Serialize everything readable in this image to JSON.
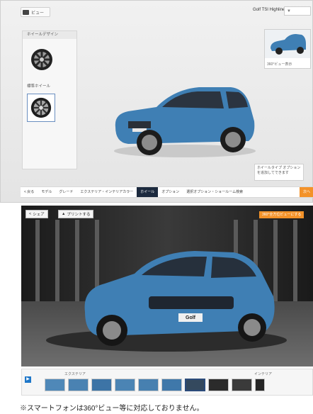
{
  "configurator": {
    "view_button_label": "ビュー",
    "model_name": "Golf TSI Highline",
    "model_select_value": "▼",
    "panel": {
      "header": "ホイールデザイン",
      "section_label": "標準ホイール"
    },
    "preview_caption": "360°ビュー表示",
    "note_text": "ホイールタイプ オプションを追加してできます",
    "steps": [
      "< 戻る",
      "モデル",
      "グレード",
      "エクステリア・インテリアカラー",
      "ホイール",
      "オプション",
      "選択オプション・ショールーム検索",
      "次へ"
    ]
  },
  "view360": {
    "share_label": "シェア",
    "print_label": "プリントする",
    "badge_text": "360°全方位ビューにする",
    "plate_text": "Golf"
  },
  "thumbnails": {
    "exterior_caption": "エクステリア",
    "interior_caption": "インテリア"
  },
  "colors": {
    "car_body": "#3f7fb4",
    "accent_orange": "#f39229",
    "step_active": "#1c2a3e"
  },
  "footnote": "※スマートフォンは360°ビュー等に対応しておりません。"
}
